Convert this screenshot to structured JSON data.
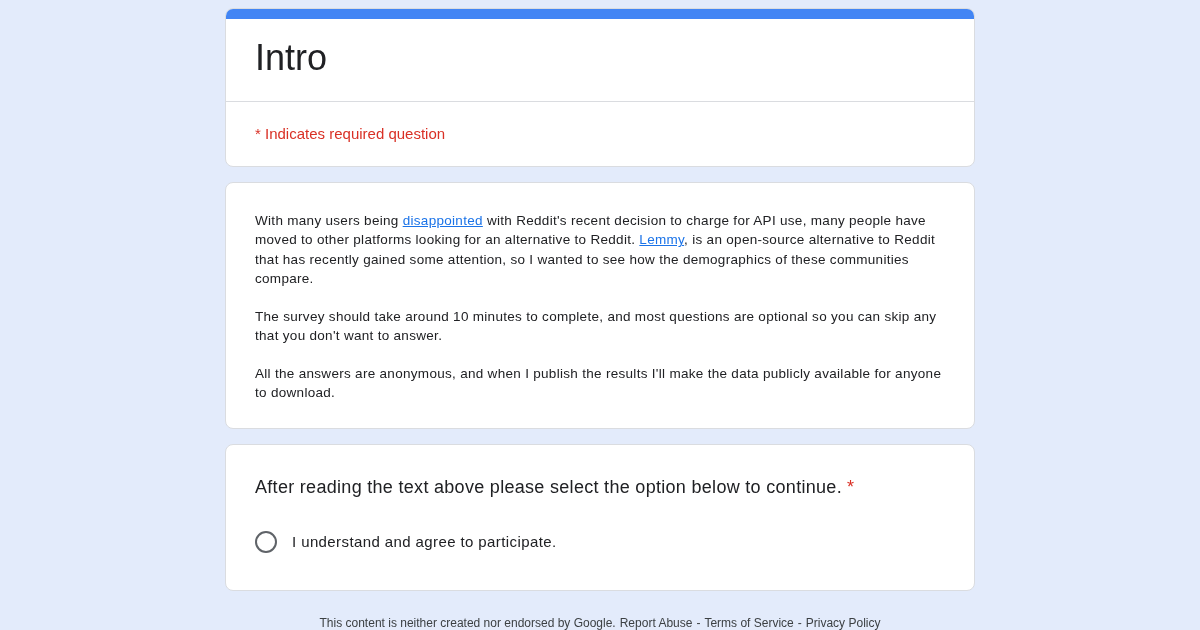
{
  "header": {
    "title": "Intro",
    "required_note": "* Indicates required question"
  },
  "description": {
    "paragraphs": [
      [
        {
          "text": "With many users being ",
          "kind": "text"
        },
        {
          "text": "disappointed",
          "kind": "link"
        },
        {
          "text": " with Reddit's recent decision to charge for API use, many people have moved to other platforms looking for an alternative to Reddit. ",
          "kind": "text"
        },
        {
          "text": "Lemmy",
          "kind": "link"
        },
        {
          "text": ", is an open-source alternative to Reddit that has recently gained some attention, so I wanted to see how the demographics of these communities compare.",
          "kind": "text"
        }
      ],
      [
        {
          "text": "The survey should take around 10 minutes to complete, and most questions are optional so you can skip any that you don't want to answer.",
          "kind": "text"
        }
      ],
      [
        {
          "text": "All the answers are anonymous, and when I publish the results I'll make the data publicly available for anyone to download.",
          "kind": "text"
        }
      ]
    ]
  },
  "question": {
    "text": "After reading the text above please select the option below to continue.",
    "required_mark": "*",
    "options": [
      {
        "label": "I understand and agree to participate.",
        "selected": false
      }
    ]
  },
  "footer": {
    "note": "This content is neither created nor endorsed by Google.",
    "separator": "-",
    "links": [
      "Report Abuse",
      "Terms of Service",
      "Privacy Policy"
    ]
  }
}
